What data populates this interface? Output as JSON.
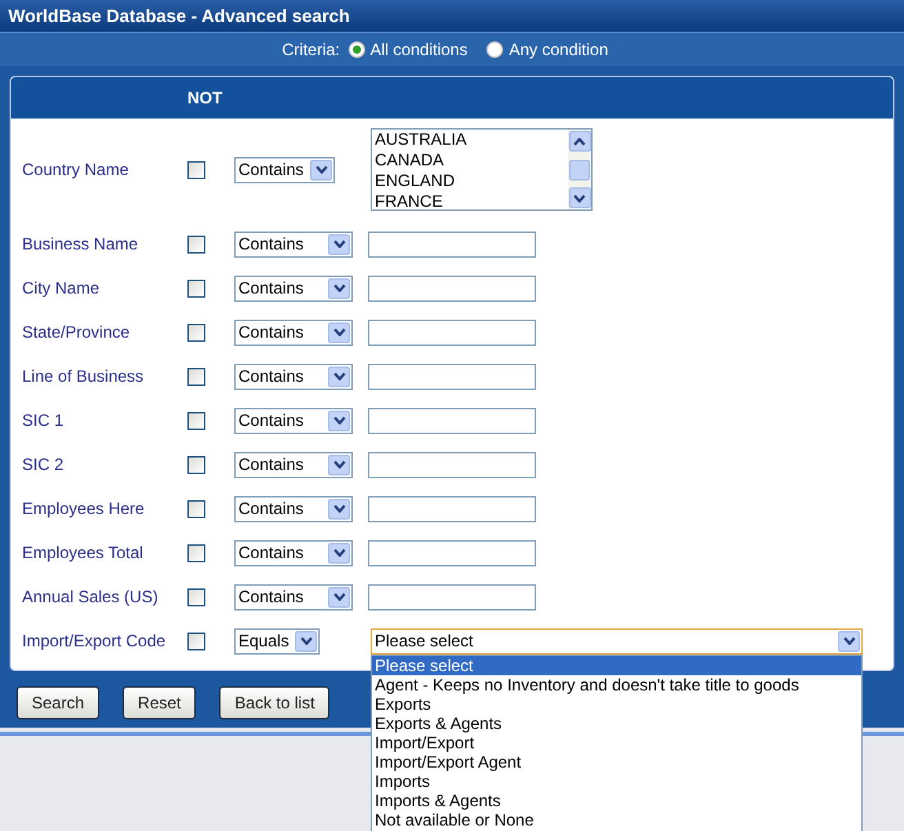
{
  "window": {
    "title": "WorldBase Database - Advanced search"
  },
  "criteria": {
    "label": "Criteria:",
    "options": [
      {
        "label": "All conditions",
        "selected": true
      },
      {
        "label": "Any condition",
        "selected": false
      }
    ]
  },
  "header": {
    "not_label": "NOT"
  },
  "rows": [
    {
      "label": "Country Name",
      "checked": false,
      "operator": "Contains",
      "kind": "listbox",
      "items": [
        "AUSTRALIA",
        "CANADA",
        "ENGLAND",
        "FRANCE"
      ]
    },
    {
      "label": "Business Name",
      "checked": false,
      "operator": "Contains",
      "kind": "text"
    },
    {
      "label": "City Name",
      "checked": false,
      "operator": "Contains",
      "kind": "text"
    },
    {
      "label": "State/Province",
      "checked": false,
      "operator": "Contains",
      "kind": "text"
    },
    {
      "label": "Line of Business",
      "checked": false,
      "operator": "Contains",
      "kind": "text"
    },
    {
      "label": "SIC 1",
      "checked": false,
      "operator": "Contains",
      "kind": "text"
    },
    {
      "label": "SIC 2",
      "checked": false,
      "operator": "Contains",
      "kind": "text"
    },
    {
      "label": "Employees Here",
      "checked": false,
      "operator": "Contains",
      "kind": "text"
    },
    {
      "label": "Employees Total",
      "checked": false,
      "operator": "Contains",
      "kind": "text"
    },
    {
      "label": "Annual Sales (US)",
      "checked": false,
      "operator": "Contains",
      "kind": "text"
    },
    {
      "label": "Import/Export Code",
      "checked": false,
      "operator": "Equals",
      "kind": "dropdown",
      "value": "Please select",
      "expanded": true,
      "options": [
        {
          "label": "Please select",
          "selected": true
        },
        {
          "label": "Agent - Keeps no Inventory and doesn't take title to goods",
          "selected": false
        },
        {
          "label": "Exports",
          "selected": false
        },
        {
          "label": "Exports & Agents",
          "selected": false
        },
        {
          "label": "Import/Export",
          "selected": false
        },
        {
          "label": "Import/Export Agent",
          "selected": false
        },
        {
          "label": "Imports",
          "selected": false
        },
        {
          "label": "Imports & Agents",
          "selected": false
        },
        {
          "label": "Not available or None",
          "selected": false
        }
      ]
    }
  ],
  "buttons": [
    "Search",
    "Reset",
    "Back to list"
  ]
}
